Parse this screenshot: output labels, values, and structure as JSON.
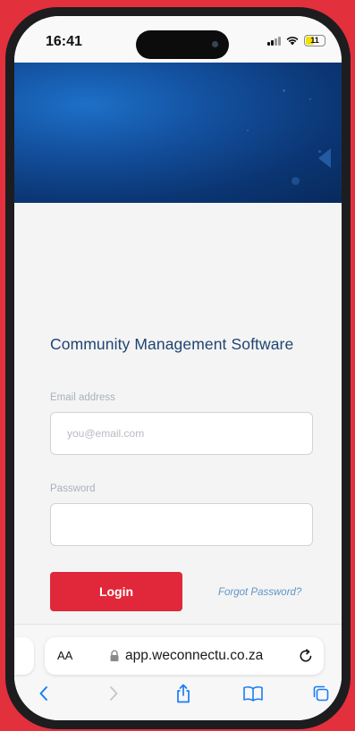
{
  "status_bar": {
    "time": "16:41",
    "battery": "11",
    "icons": [
      "signal-icon",
      "wifi-icon",
      "battery-icon"
    ]
  },
  "banner": {
    "colors": {
      "dark": "#082a5c",
      "mid": "#13509e",
      "light": "#1d70c8"
    }
  },
  "login": {
    "title": "Community Management Software",
    "email_label": "Email address",
    "email_placeholder": "you@email.com",
    "email_value": "",
    "password_label": "Password",
    "password_value": "",
    "login_label": "Login",
    "forgot_label": "Forgot Password?",
    "colors": {
      "accent": "#e0283a",
      "title": "#1f4470",
      "link": "#5f95c4"
    }
  },
  "browser": {
    "aa_label": "AA",
    "url": "app.weconnectu.co.za",
    "toolbar_icons": [
      "back-icon",
      "forward-icon",
      "share-icon",
      "bookmarks-icon",
      "tabs-icon"
    ]
  },
  "frame": {
    "background": "#e3303d"
  }
}
